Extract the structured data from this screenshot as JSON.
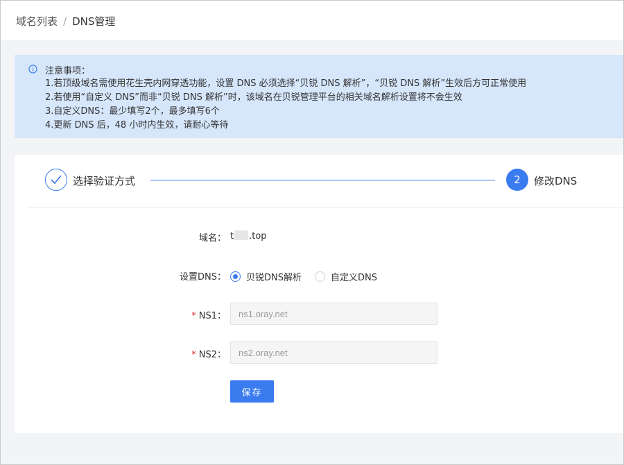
{
  "breadcrumb": {
    "parent": "域名列表",
    "separator": "/",
    "current": "DNS管理"
  },
  "notice": {
    "title": "注意事项：",
    "lines": [
      "1.若顶级域名需使用花生壳内网穿透功能，设置 DNS 必须选择“贝锐 DNS 解析”，“贝锐 DNS 解析”生效后方可正常使用",
      "2.若使用“自定义 DNS”而非“贝锐 DNS 解析”时，该域名在贝锐管理平台的相关域名解析设置将不会生效",
      "3.自定义DNS：最少填写2个，最多填写6个",
      "4.更新 DNS 后，48 小时内生效，请耐心等待"
    ]
  },
  "steps": {
    "step1": {
      "label": "选择验证方式",
      "status": "completed"
    },
    "step2": {
      "number": "2",
      "label": "修改DNS",
      "status": "active"
    }
  },
  "form": {
    "domain_label": "域名：",
    "domain_prefix": "t",
    "domain_suffix": ".top",
    "dns_label": "设置DNS：",
    "dns_options": [
      {
        "label": "贝锐DNS解析",
        "selected": true
      },
      {
        "label": "自定义DNS",
        "selected": false
      }
    ],
    "required_mark": "*",
    "ns1_label": "NS1：",
    "ns1_placeholder": "ns1.oray.net",
    "ns2_label": "NS2：",
    "ns2_placeholder": "ns2.oray.net",
    "save_label": "保存"
  },
  "colors": {
    "accent": "#3a7bf0",
    "notice_bg": "#d6e6fb",
    "required": "#e02b2b"
  }
}
